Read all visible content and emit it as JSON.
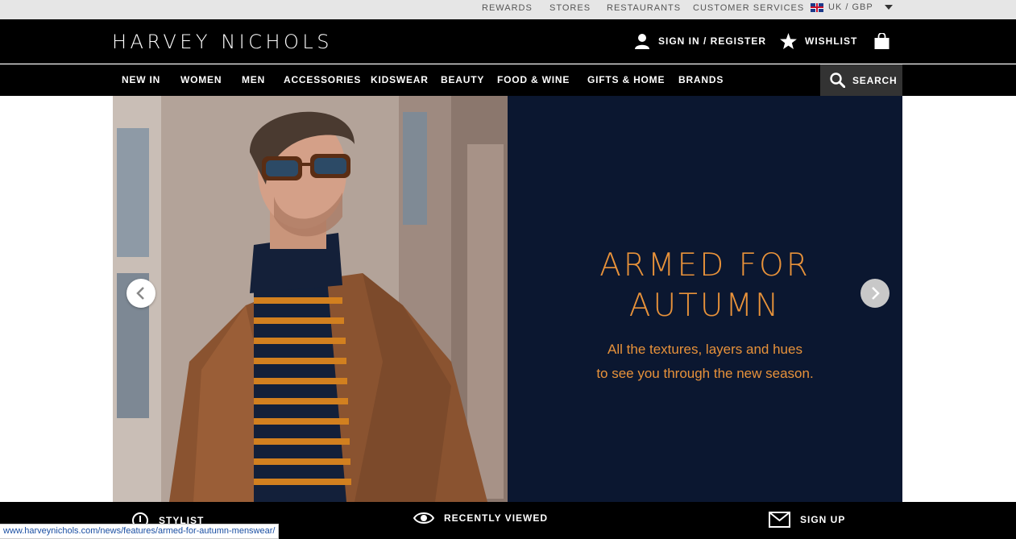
{
  "utility": {
    "links": [
      "REWARDS",
      "STORES",
      "RESTAURANTS",
      "CUSTOMER SERVICES"
    ],
    "locale": "UK / GBP"
  },
  "header": {
    "logo": "HARVEY NICHOLS",
    "sign_in": "SIGN IN / REGISTER",
    "wishlist": "WISHLIST"
  },
  "nav": {
    "items": [
      "NEW IN",
      "WOMEN",
      "MEN",
      "ACCESSORIES",
      "KIDSWEAR",
      "BEAUTY",
      "FOOD & WINE",
      "GIFTS & HOME",
      "BRANDS"
    ],
    "search": "SEARCH"
  },
  "hero": {
    "headline_line1": "ARMED FOR",
    "headline_line2": "AUTUMN",
    "subline_line1": "All the textures, layers and hues",
    "subline_line2": "to see you through the new season.",
    "accent_color": "#e8923a",
    "panel_color": "#0b1730"
  },
  "footer": {
    "stylist": "STYLIST",
    "recently_viewed": "RECENTLY VIEWED",
    "sign_up": "SIGN UP"
  },
  "status_url": "www.harveynichols.com/news/features/armed-for-autumn-menswear/"
}
